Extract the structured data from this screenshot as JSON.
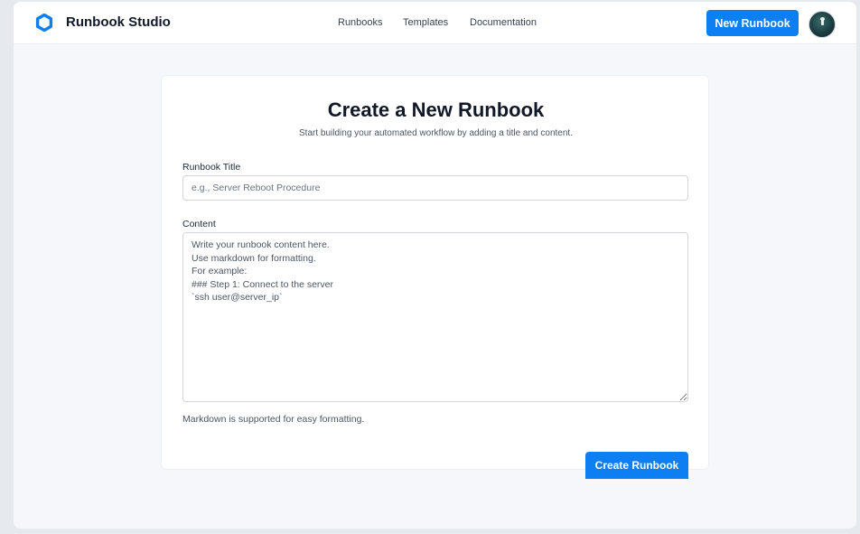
{
  "header": {
    "brand": "Runbook Studio",
    "nav": [
      "Runbooks",
      "Templates",
      "Documentation"
    ],
    "new_button": "New Runbook",
    "logo_icon": "ring-logo-icon",
    "accent_color": "#0d7ff2"
  },
  "form": {
    "title": "Create a New Runbook",
    "subtitle": "Start building your automated workflow by adding a title and content.",
    "title_label": "Runbook Title",
    "title_placeholder": "e.g., Server Reboot Procedure",
    "title_value": "",
    "content_label": "Content",
    "content_placeholder": "Write your runbook content here.\nUse markdown for formatting.\nFor example:\n### Step 1: Connect to the server\n`ssh user@server_ip`",
    "content_value": "",
    "help_text": "Markdown is supported for easy formatting.",
    "submit_label": "Create Runbook"
  }
}
